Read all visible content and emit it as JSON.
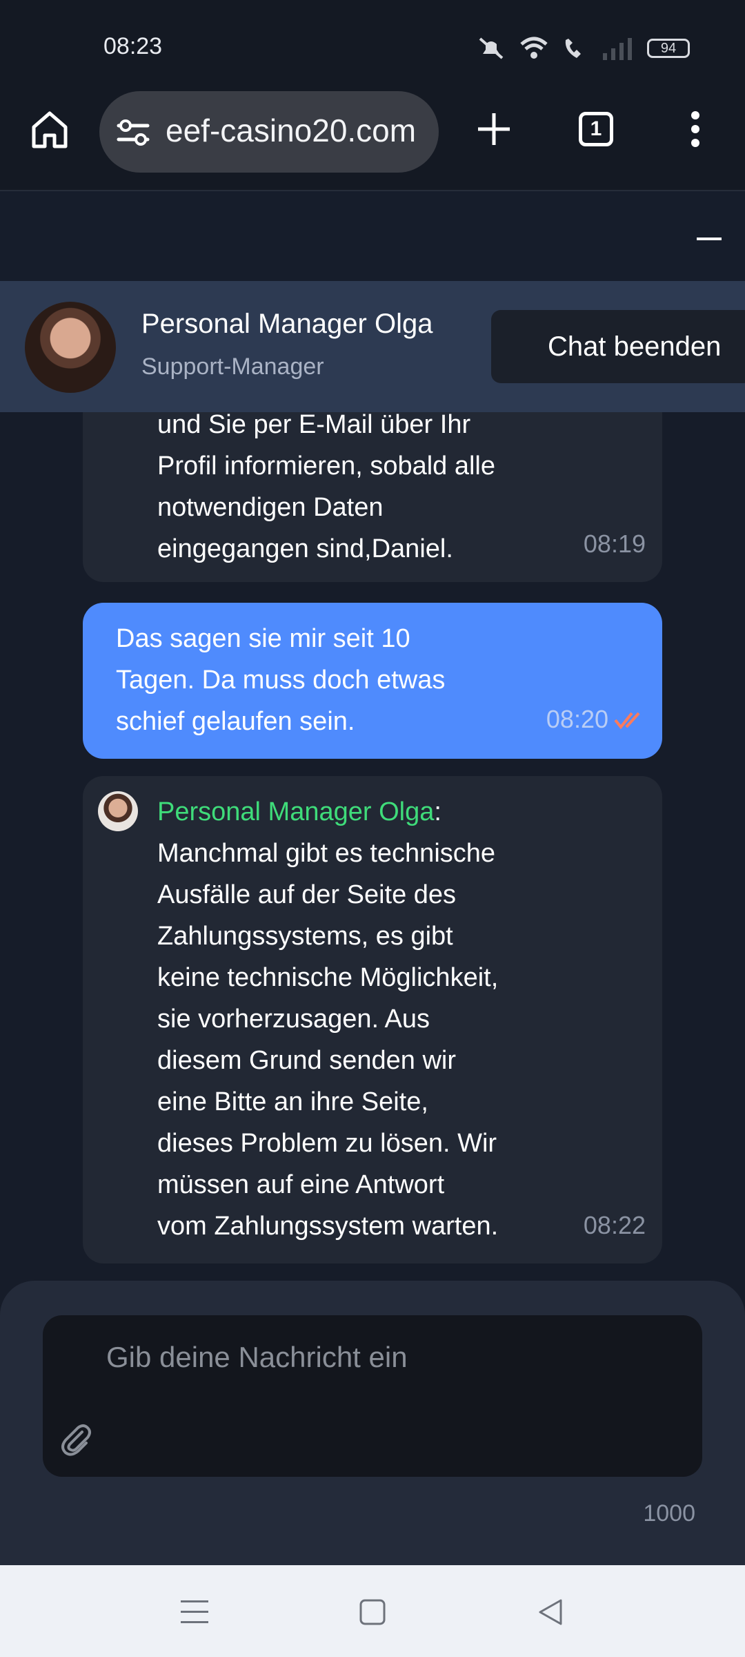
{
  "status": {
    "time": "08:23",
    "battery": "94"
  },
  "browser": {
    "url": "eef-casino20.com",
    "tab_count": "1"
  },
  "chat_header": {
    "manager_name": "Personal Manager Olga",
    "manager_role": "Support-Manager",
    "end_chat_label": "Chat beenden"
  },
  "messages": [
    {
      "lines": [
        "und Sie per E-Mail über Ihr",
        "Profil informieren, sobald alle",
        "notwendigen Daten",
        "eingegangen sind,Daniel."
      ],
      "time": "08:19"
    },
    {
      "lines": [
        "Das sagen sie mir seit 10",
        "Tagen. Da muss doch etwas",
        "schief gelaufen sein."
      ],
      "time": "08:20"
    },
    {
      "sender": "Personal Manager Olga",
      "lines": [
        "Manchmal gibt es technische",
        "Ausfälle auf der Seite des",
        "Zahlungssystems, es gibt",
        "keine technische Möglichkeit,",
        "sie vorherzusagen. Aus",
        "diesem Grund senden wir",
        "eine Bitte an ihre Seite,",
        "dieses Problem zu lösen. Wir",
        "müssen auf eine Antwort",
        "vom Zahlungssystem warten."
      ],
      "time": "08:22"
    }
  ],
  "composer": {
    "placeholder": "Gib deine Nachricht ein",
    "char_limit": "1000"
  },
  "colors": {
    "outgoing_bubble": "#4f8bfd",
    "sender_name": "#3fdc7a",
    "read_ticks": "#ff7b5c"
  }
}
